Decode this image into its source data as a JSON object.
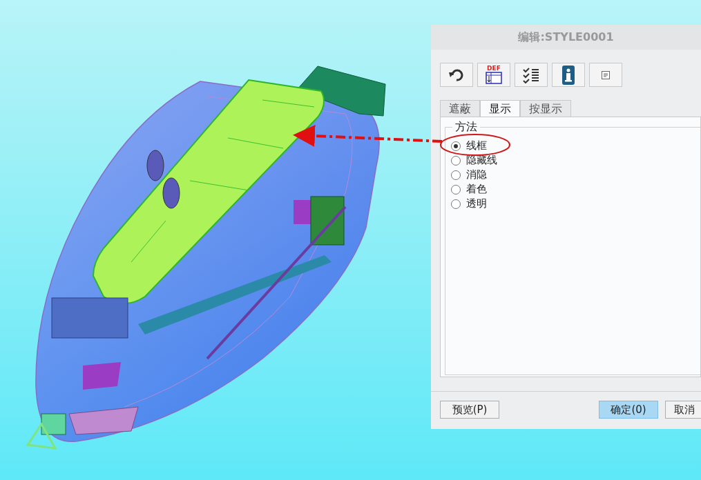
{
  "dialog": {
    "title": "编辑:STYLE0001",
    "toolbar": [
      {
        "kind": "undo"
      },
      {
        "kind": "def",
        "label": "DEF"
      },
      {
        "kind": "checklist"
      },
      {
        "kind": "info"
      },
      {
        "kind": "note"
      }
    ],
    "tabs": [
      {
        "label": "遮蔽",
        "selected": false
      },
      {
        "label": "显示",
        "selected": true
      },
      {
        "label": "按显示",
        "selected": false
      }
    ],
    "group": {
      "legend": "方法",
      "options": [
        {
          "label": "线框",
          "selected": true
        },
        {
          "label": "隐藏线",
          "selected": false
        },
        {
          "label": "消隐",
          "selected": false
        },
        {
          "label": "着色",
          "selected": false
        },
        {
          "label": "透明",
          "selected": false
        }
      ]
    },
    "buttons": [
      {
        "label": "预览(P)",
        "default": false
      },
      {
        "label": "确定(0)",
        "default": true
      },
      {
        "label": "取消",
        "default": false
      }
    ]
  }
}
